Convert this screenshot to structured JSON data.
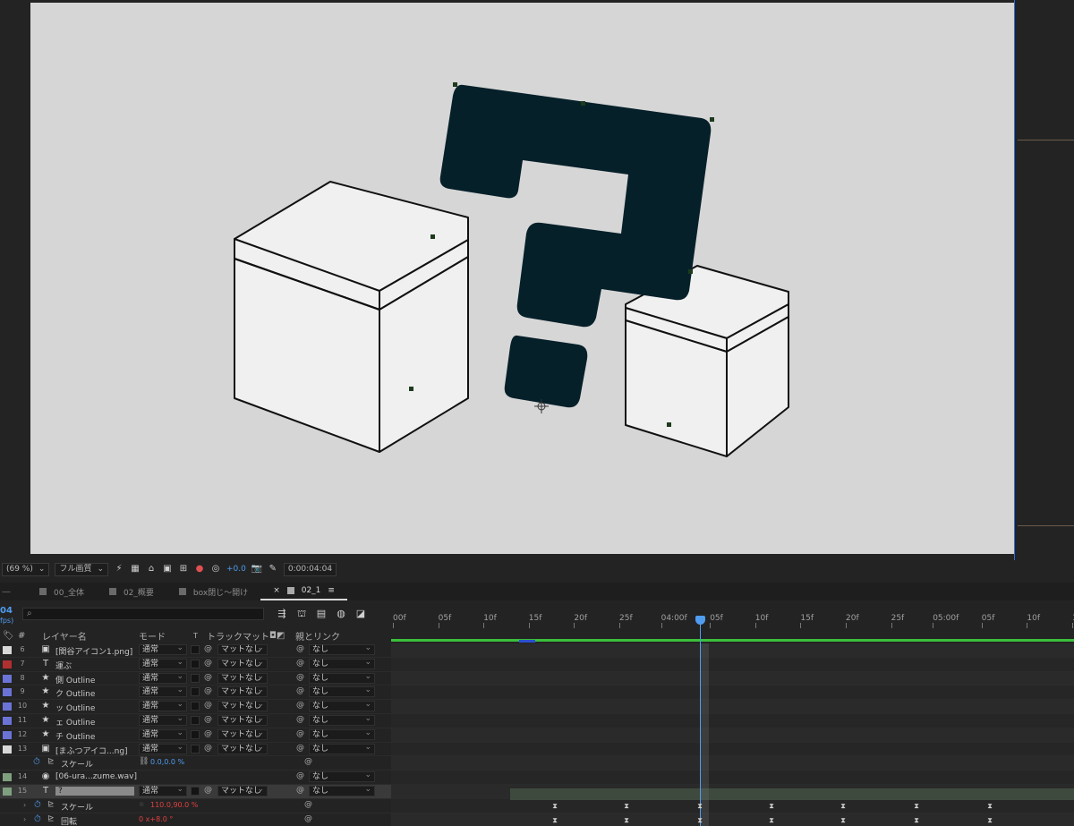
{
  "toolbar": {
    "zoom": "(69 %)",
    "quality": "フル画質",
    "exposure": "+0.0",
    "timecode": "0:00:04:04"
  },
  "tabs": [
    {
      "label": "00_全体"
    },
    {
      "label": "02_概要"
    },
    {
      "label": "box閉じ～開け"
    },
    {
      "label": "02_1"
    }
  ],
  "timeline": {
    "current_frame": "04",
    "fps_hint": "fps)",
    "search_placeholder": "⌕",
    "columns": {
      "num": "#",
      "name": "レイヤー名",
      "mode": "モード",
      "t": "T",
      "trackmatte": "トラックマット",
      "parent": "親とリンク"
    },
    "ruler": [
      "00f",
      "05f",
      "10f",
      "15f",
      "20f",
      "25f",
      "04:00f",
      "05f",
      "10f",
      "15f",
      "20f",
      "25f",
      "05:00f",
      "05f",
      "10f",
      "15"
    ],
    "layers": [
      {
        "num": "6",
        "icon": "▣",
        "name": "[関谷アイコン1.png]",
        "mode": "通常",
        "matte": "マットなし",
        "parent": "なし",
        "color": "#d8d8d8"
      },
      {
        "num": "7",
        "icon": "T",
        "name": "運ぶ",
        "mode": "通常",
        "matte": "マットなし",
        "parent": "なし",
        "color": "#b03030"
      },
      {
        "num": "8",
        "icon": "★",
        "name": "側 Outline",
        "mode": "通常",
        "matte": "マットなし",
        "parent": "なし",
        "color": "#6b74d6"
      },
      {
        "num": "9",
        "icon": "★",
        "name": "ク Outline",
        "mode": "通常",
        "matte": "マットなし",
        "parent": "なし",
        "color": "#6b74d6"
      },
      {
        "num": "10",
        "icon": "★",
        "name": "ッ Outline",
        "mode": "通常",
        "matte": "マットなし",
        "parent": "なし",
        "color": "#6b74d6"
      },
      {
        "num": "11",
        "icon": "★",
        "name": "ェ Outline",
        "mode": "通常",
        "matte": "マットなし",
        "parent": "なし",
        "color": "#6b74d6"
      },
      {
        "num": "12",
        "icon": "★",
        "name": "チ Outline",
        "mode": "通常",
        "matte": "マットなし",
        "parent": "なし",
        "color": "#6b74d6"
      },
      {
        "num": "13",
        "icon": "▣",
        "name": "[まふつアイコ...ng]",
        "mode": "通常",
        "matte": "マットなし",
        "parent": "なし",
        "color": "#d8d8d8"
      }
    ],
    "prop13": {
      "name": "スケール",
      "value": "0.0,0.0 %"
    },
    "layer14": {
      "num": "14",
      "icon": "◉",
      "name": "[06-ura...zume.wav]",
      "parent": "なし",
      "color": "#7fa07f"
    },
    "layer15": {
      "num": "15",
      "icon": "T",
      "name": "?",
      "mode": "通常",
      "matte": "マットなし",
      "parent": "なし",
      "color": "#7fa07f"
    },
    "prop15a": {
      "name": "スケール",
      "value": "110.0,90.0 %"
    },
    "prop15b": {
      "name": "回転",
      "value": "0 x+8.0 °"
    }
  }
}
